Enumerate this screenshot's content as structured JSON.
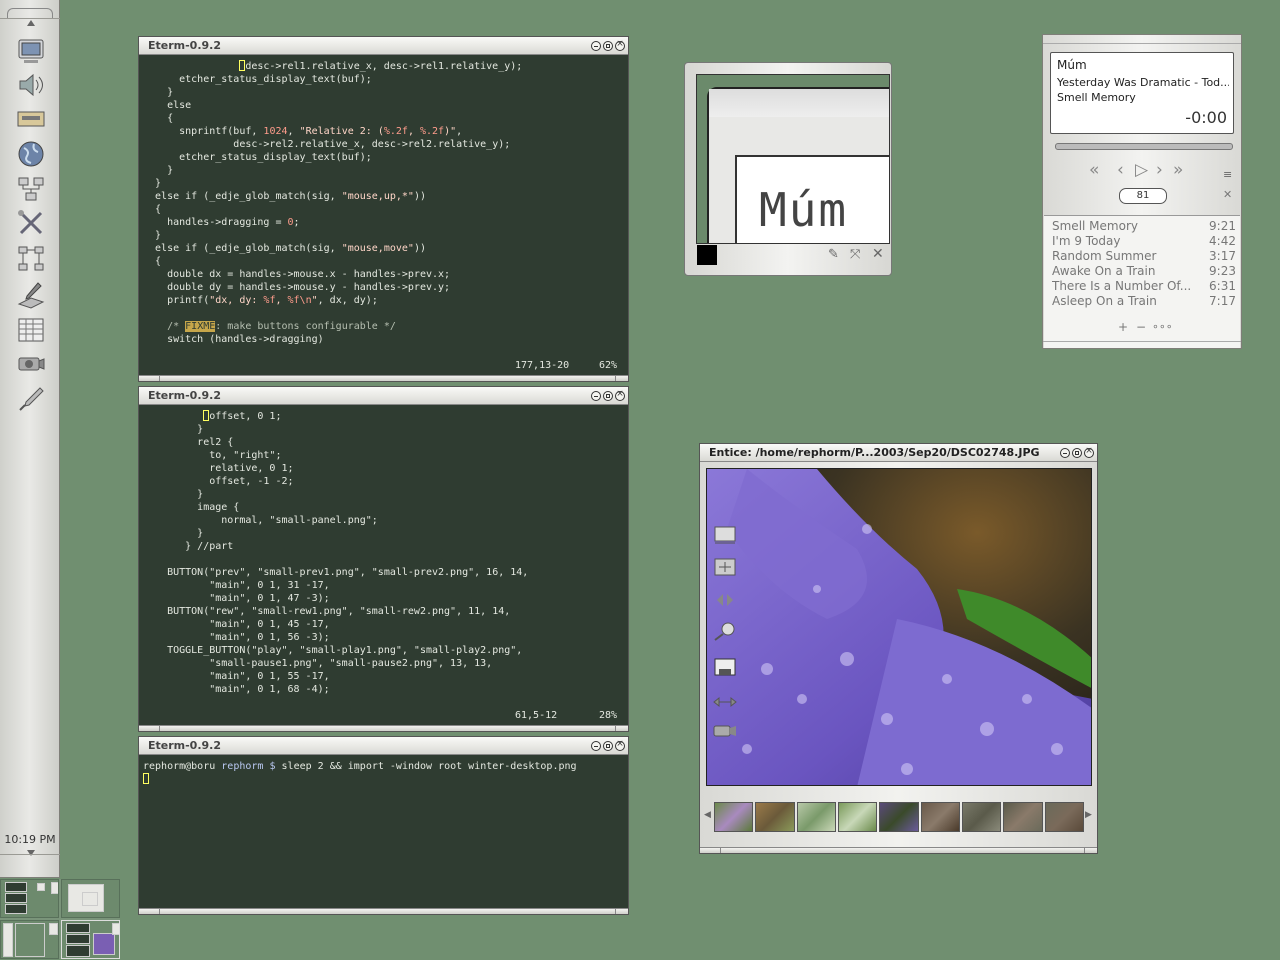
{
  "shelf": {
    "icons": [
      "display-settings-icon",
      "sound-icon",
      "drive-icon",
      "globe-icon",
      "network-icon",
      "tools-icon",
      "network-map-icon",
      "drawing-icon",
      "spreadsheet-icon",
      "camera-icon",
      "pipette-icon"
    ],
    "clock": "10:19 PM"
  },
  "eterm1": {
    "title": "Eterm-0.9.2",
    "status_pos": "177,13-20",
    "status_pct": "62%"
  },
  "eterm2": {
    "title": "Eterm-0.9.2",
    "status_pos": "61,5-12",
    "status_pct": "28%"
  },
  "eterm3": {
    "title": "Eterm-0.9.2",
    "prompt_user": "rephorm@boru",
    "prompt_dir": "rephorm",
    "prompt_symbol": "$",
    "command": "sleep 2 && import -window root winter-desktop.png"
  },
  "magnifier": {
    "zoom_text": "Múm"
  },
  "player": {
    "artist": "Múm",
    "album": "Yesterday Was Dramatic - Tod...",
    "track": "Smell Memory",
    "time": "-0:00",
    "volume": "81",
    "playlist": [
      {
        "title": "Smell Memory",
        "length": "9:21"
      },
      {
        "title": "I'm 9 Today",
        "length": "4:42"
      },
      {
        "title": "Random Summer",
        "length": "3:17"
      },
      {
        "title": "Awake On a Train",
        "length": "9:23"
      },
      {
        "title": "There Is a Number Of...",
        "length": "6:31"
      },
      {
        "title": "Asleep On a Train",
        "length": "7:17"
      }
    ]
  },
  "entice": {
    "title": "Entice: /home/rephorm/P...2003/Sep20/DSC02748.JPG"
  }
}
